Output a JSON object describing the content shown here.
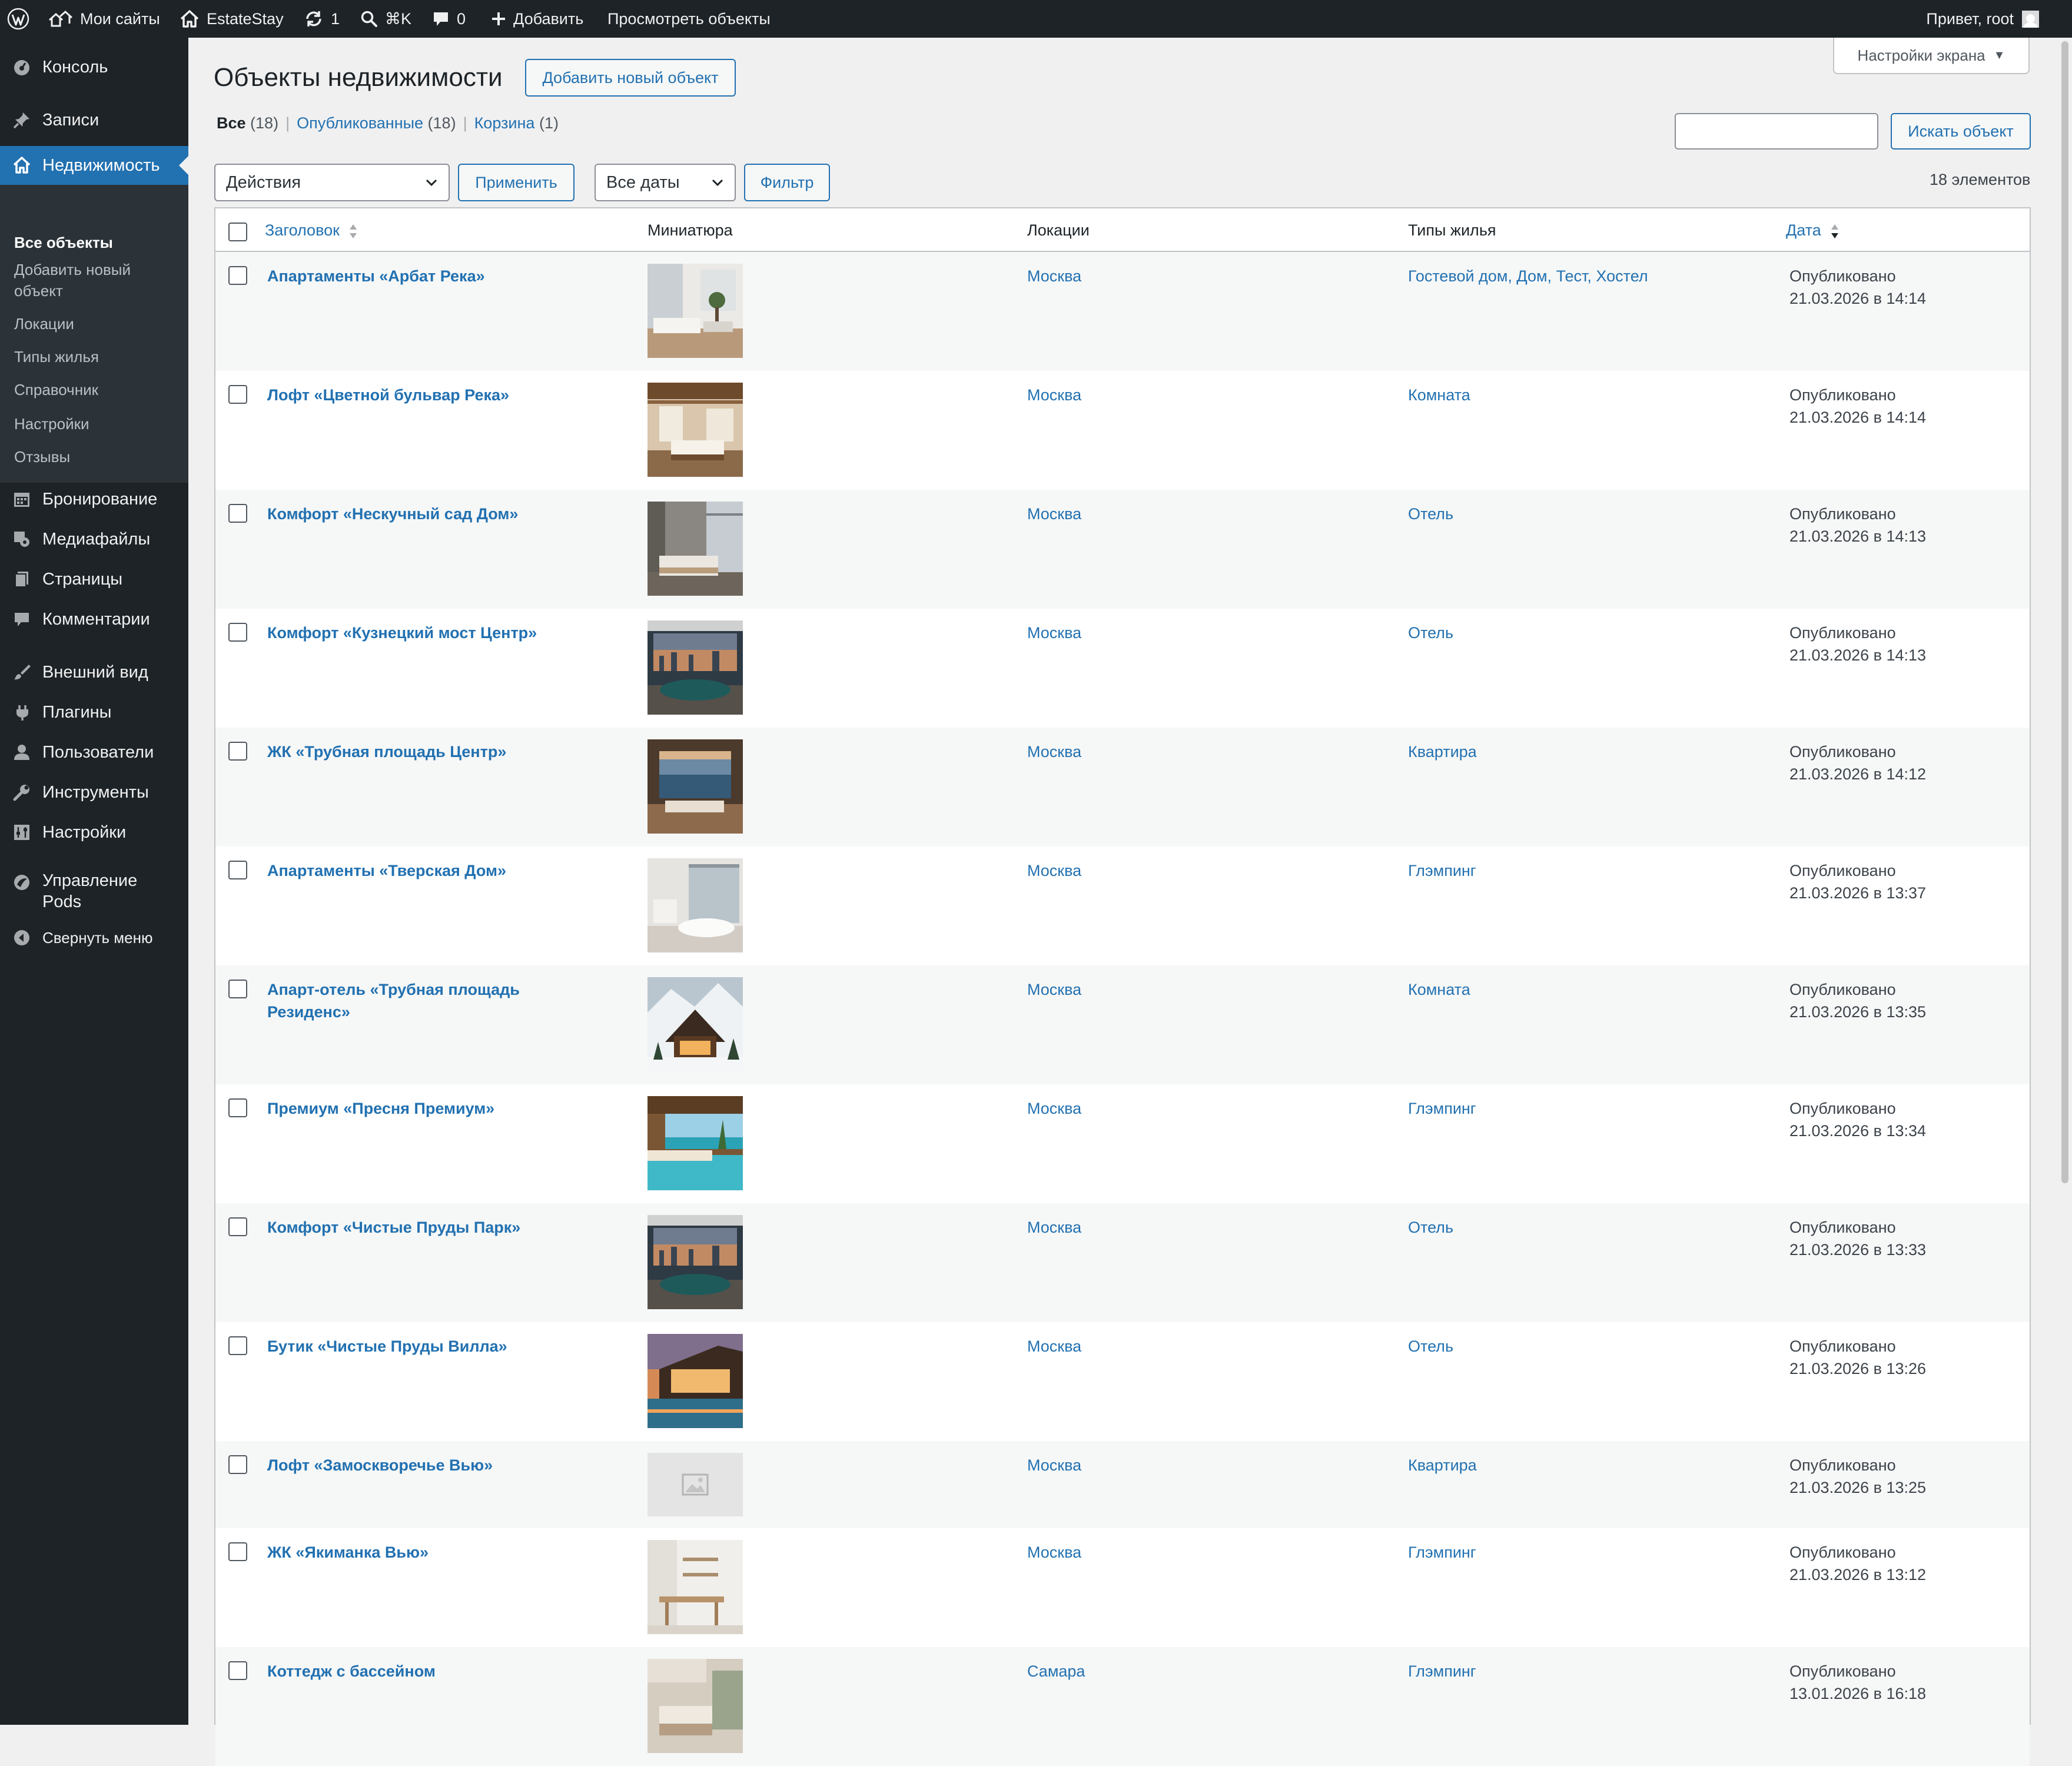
{
  "adminbar": {
    "my_sites": "Мои сайты",
    "site_name": "EstateStay",
    "updates_count": "1",
    "search_shortcut": "⌘K",
    "comments_count": "0",
    "add_new": "Добавить",
    "view_objects": "Просмотреть объекты",
    "greeting": "Привет, root"
  },
  "sidebar": {
    "items": [
      {
        "label": "Консоль",
        "icon": "dashboard-icon"
      },
      {
        "label": "Записи",
        "icon": "pin-icon"
      },
      {
        "label": "Недвижимость",
        "icon": "home-icon"
      },
      {
        "label": "Бронирование",
        "icon": "calendar-icon"
      },
      {
        "label": "Медиафайлы",
        "icon": "media-icon"
      },
      {
        "label": "Страницы",
        "icon": "pages-icon"
      },
      {
        "label": "Комментарии",
        "icon": "comment-icon"
      },
      {
        "label": "Внешний вид",
        "icon": "brush-icon"
      },
      {
        "label": "Плагины",
        "icon": "plugin-icon"
      },
      {
        "label": "Пользователи",
        "icon": "user-icon"
      },
      {
        "label": "Инструменты",
        "icon": "wrench-icon"
      },
      {
        "label": "Настройки",
        "icon": "settings-icon"
      },
      {
        "label": "Управление Pods",
        "icon": "pods-icon"
      },
      {
        "label": "Свернуть меню",
        "icon": "collapse-icon"
      }
    ],
    "submenu": [
      "Все объекты",
      "Добавить новый объект",
      "Локации",
      "Типы жилья",
      "Справочник",
      "Настройки",
      "Отзывы"
    ]
  },
  "page": {
    "screen_options": "Настройки экрана",
    "title": "Объекты недвижимости",
    "add_new_button": "Добавить новый объект",
    "filters": {
      "all_label": "Все",
      "all_count": "(18)",
      "published_label": "Опубликованные",
      "published_count": "(18)",
      "trash_label": "Корзина",
      "trash_count": "(1)"
    },
    "search_button": "Искать объект",
    "bulk_action": "Действия",
    "apply_button": "Применить",
    "dates_select": "Все даты",
    "filter_button": "Фильтр",
    "items_count": "18 элементов"
  },
  "table": {
    "columns": {
      "title": "Заголовок",
      "thumbnail": "Миниатюра",
      "locations": "Локации",
      "types": "Типы жилья",
      "date": "Дата"
    },
    "rows": [
      {
        "title": "Апартаменты «Арбат Река»",
        "location": "Москва",
        "types": "Гостевой дом, Дом, Тест, Хостел",
        "status": "Опубликовано",
        "date": "21.03.2026 в 14:14",
        "thumb": "white-living-room"
      },
      {
        "title": "Лофт «Цветной бульвар Река»",
        "location": "Москва",
        "types": "Комната",
        "status": "Опубликовано",
        "date": "21.03.2026 в 14:14",
        "thumb": "wooden-loft"
      },
      {
        "title": "Комфорт «Нескучный сад Дом»",
        "location": "Москва",
        "types": "Отель",
        "status": "Опубликовано",
        "date": "21.03.2026 в 14:13",
        "thumb": "grey-bedroom"
      },
      {
        "title": "Комфорт «Кузнецкий мост Центр»",
        "location": "Москва",
        "types": "Отель",
        "status": "Опубликовано",
        "date": "21.03.2026 в 14:13",
        "thumb": "city-view-lounge"
      },
      {
        "title": "ЖК «Трубная площадь Центр»",
        "location": "Москва",
        "types": "Квартира",
        "status": "Опубликовано",
        "date": "21.03.2026 в 14:12",
        "thumb": "sea-view-room"
      },
      {
        "title": "Апартаменты «Тверская Дом»",
        "location": "Москва",
        "types": "Глэмпинг",
        "status": "Опубликовано",
        "date": "21.03.2026 в 13:37",
        "thumb": "white-bathroom"
      },
      {
        "title": "Апарт-отель «Трубная площадь Резиденс»",
        "location": "Москва",
        "types": "Комната",
        "status": "Опубликовано",
        "date": "21.03.2026 в 13:35",
        "thumb": "snow-chalet"
      },
      {
        "title": "Премиум «Пресня Премиум»",
        "location": "Москва",
        "types": "Глэмпинг",
        "status": "Опубликовано",
        "date": "21.03.2026 в 13:34",
        "thumb": "beach-pool"
      },
      {
        "title": "Комфорт «Чистые Пруды Парк»",
        "location": "Москва",
        "types": "Отель",
        "status": "Опубликовано",
        "date": "21.03.2026 в 13:33",
        "thumb": "city-view-lounge"
      },
      {
        "title": "Бутик «Чистые Пруды Вилла»",
        "location": "Москва",
        "types": "Отель",
        "status": "Опубликовано",
        "date": "21.03.2026 в 13:26",
        "thumb": "sunset-villa"
      },
      {
        "title": "Лофт «Замоскворечье Вью»",
        "location": "Москва",
        "types": "Квартира",
        "status": "Опубликовано",
        "date": "21.03.2026 в 13:25",
        "thumb": "placeholder"
      },
      {
        "title": "ЖК «Якиманка Вью»",
        "location": "Москва",
        "types": "Глэмпинг",
        "status": "Опубликовано",
        "date": "21.03.2026 в 13:12",
        "thumb": "white-kitchen"
      },
      {
        "title": "Коттедж с бассейном",
        "location": "Самара",
        "types": "Глэмпинг",
        "status": "Опубликовано",
        "date": "13.01.2026 в 16:18",
        "thumb": "beige-bedroom"
      }
    ]
  },
  "colors": {
    "adminbar_bg": "#1d2327",
    "accent": "#2271b1",
    "page_bg": "#f0f0f1"
  }
}
